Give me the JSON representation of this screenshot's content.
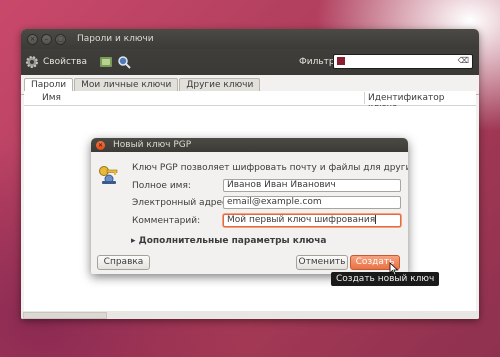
{
  "window": {
    "title": "Пароли и ключи"
  },
  "toolbar": {
    "properties_label": "Свойства",
    "filter_label": "Фильтр:",
    "filter_value": ""
  },
  "tabs": [
    {
      "label": "Пароли"
    },
    {
      "label": "Мои личные ключи"
    },
    {
      "label": "Другие ключи"
    }
  ],
  "list": {
    "columns": [
      "Имя",
      "Идентификатор ключа"
    ]
  },
  "dialog": {
    "title": "Новый ключ PGP",
    "description": "Ключ PGP позволяет шифровать почту и файлы для других людей.",
    "fields": [
      {
        "label": "Полное имя:",
        "value": "Иванов Иван Иванович"
      },
      {
        "label": "Электронный адрес:",
        "value": "email@example.com"
      },
      {
        "label": "Комментарий:",
        "value": "Мой первый ключ шифрования"
      }
    ],
    "expander_label": "Дополнительные параметры ключа",
    "help_button": "Справка",
    "cancel_button": "Отменить",
    "create_button": "Создать",
    "tooltip": "Создать новый ключ"
  },
  "colors": {
    "accent": "#ea7247",
    "titlebar": "#3c3b37",
    "window_bg": "#f2f1f0"
  },
  "icons": [
    "gear-icon",
    "keyring-icon",
    "search-icon",
    "close-icon",
    "keys-icon",
    "expander-arrow-icon",
    "mouse-cursor-icon"
  ]
}
